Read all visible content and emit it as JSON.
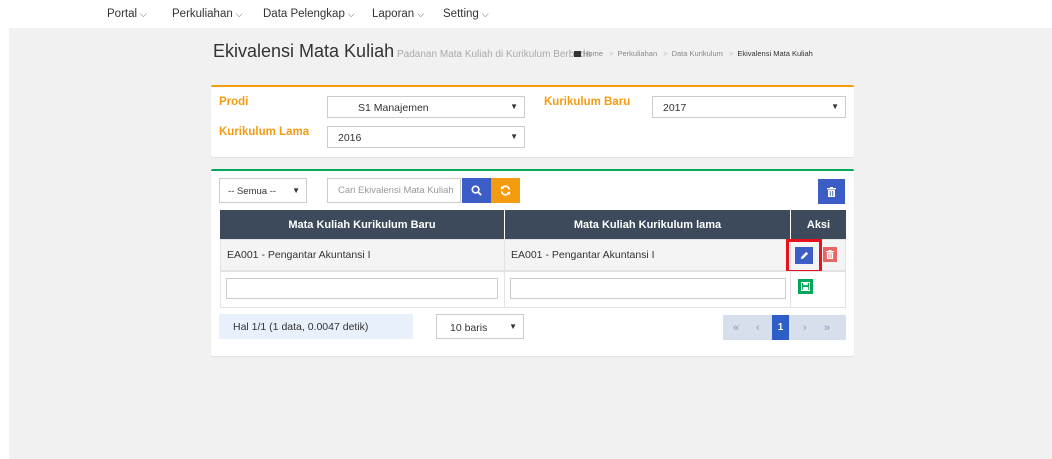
{
  "nav": {
    "items": [
      {
        "label": "Portal",
        "name": "nav-portal"
      },
      {
        "label": "Perkuliahan",
        "name": "nav-perkuliahan"
      },
      {
        "label": "Data Pelengkap",
        "name": "nav-data-pelengkap"
      },
      {
        "label": "Laporan",
        "name": "nav-laporan"
      },
      {
        "label": "Setting",
        "name": "nav-setting"
      }
    ]
  },
  "header": {
    "title": "Ekivalensi Mata Kuliah",
    "subtitle": "Padanan Mata Kuliah di Kurikulum Berbeda",
    "breadcrumb": [
      "Home",
      "Perkuliahan",
      "Data Kurikulum",
      "Ekivalensi Mata Kuliah"
    ]
  },
  "filter": {
    "prodi_label": "Prodi",
    "prodi_value": "S1 Manajemen",
    "kurikulum_baru_label": "Kurikulum Baru",
    "kurikulum_baru_value": "2017",
    "kurikulum_lama_label": "Kurikulum Lama",
    "kurikulum_lama_value": "2016"
  },
  "list": {
    "filter_select": "-- Semua --",
    "search_placeholder": "Cari Ekivalensi Mata Kuliah",
    "columns": [
      "Mata Kuliah Kurikulum Baru",
      "Mata Kuliah Kurikulum lama",
      "Aksi"
    ],
    "rows": [
      {
        "baru": "EA001 - Pengantar Akuntansi I",
        "lama": "EA001 - Pengantar Akuntansi I"
      }
    ],
    "info": "Hal 1/1 (1 data, 0.0047 detik)",
    "per_page": "10 baris",
    "pager": {
      "first": "«",
      "prev": "‹",
      "current": "1",
      "next": "›",
      "last": "»"
    }
  },
  "colors": {
    "accent_orange": "#f39c12",
    "accent_green": "#00a65a",
    "primary_blue": "#3c5cc6",
    "danger_red": "#e96464",
    "table_header": "#3d4a5c"
  }
}
